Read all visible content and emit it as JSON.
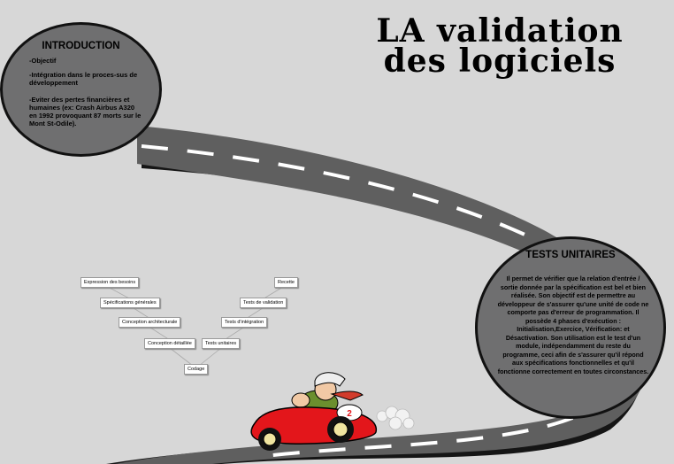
{
  "title": "LA validation des logiciels",
  "introduction": {
    "heading": "INTRODUCTION",
    "items": [
      "-Objectif",
      "-Intégration dans le proces-sus de développement",
      "-Eviter des pertes financières et humaines (ex: Crash Airbus A320 en 1992 provoquant 87 morts sur le Mont St-Odile)."
    ]
  },
  "tests_unitaires": {
    "heading": "TESTS UNITAIRES",
    "text": "Il permet de vérifier que la relation d'entrée / sortie donnée par la spécification est bel et bien réalisée. Son objectif est de permettre au développeur de s'assurer qu'une unité de code ne comporte pas d'erreur de programmation. Il possède 4 phases d'exécution : Initialisation,Exercice, Vérification: et Désactivation. Son utilisation est le test d'un module, indépendamment du reste du programme, ceci afin de s'assurer qu'il répond aux spécifications fonctionnelles et qu'il fonctionne correctement en toutes circonstances."
  },
  "v_model": {
    "left": [
      "Expression des besoins",
      "Spécifications générales",
      "Conception architecturale",
      "Conception détaillée"
    ],
    "bottom": "Codage",
    "right": [
      "Recette",
      "Tests de validation",
      "Tests d'intégration",
      "Tests unitaires"
    ]
  },
  "car_number": "2",
  "colors": {
    "background": "#d7d7d7",
    "road": "#5f5f5f",
    "bubble": "#6f6f70",
    "car": "#e3161b"
  }
}
